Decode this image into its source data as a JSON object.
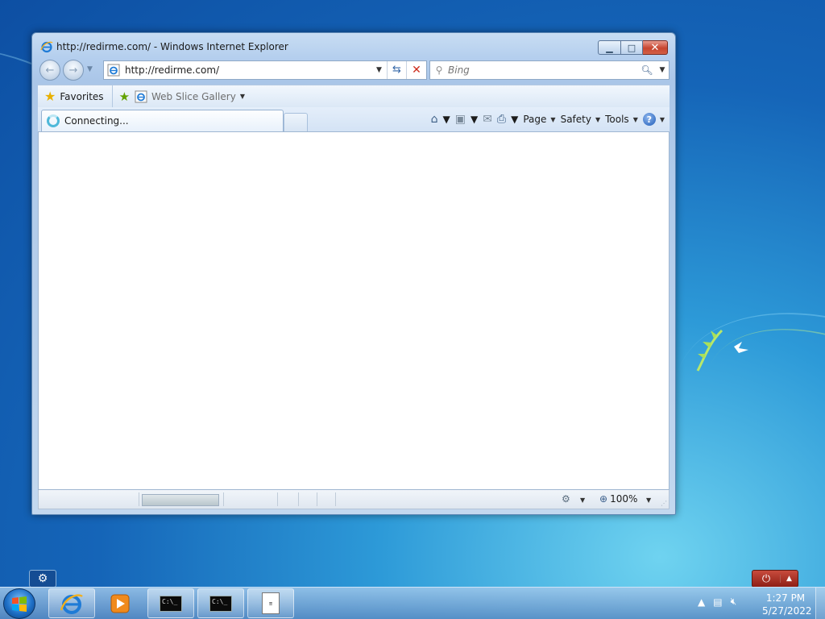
{
  "window": {
    "title": "http://redirme.com/ - Windows Internet Explorer",
    "minimize_glyph": "▁",
    "maximize_glyph": "□",
    "close_glyph": "✕"
  },
  "navbar": {
    "back_glyph": "←",
    "forward_glyph": "→",
    "address": "http://redirme.com/",
    "search_placeholder": "Bing"
  },
  "favorites_bar": {
    "favorites_label": "Favorites",
    "web_slice_label": "Web Slice Gallery"
  },
  "tabs": [
    {
      "label": "Connecting...",
      "state": "loading"
    }
  ],
  "command_bar": {
    "page_label": "Page",
    "safety_label": "Safety",
    "tools_label": "Tools"
  },
  "statusbar": {
    "progress": 1.0,
    "zoom": "100%"
  },
  "taskbar": {
    "clock_time": "1:27 PM",
    "clock_date": "5/27/2022",
    "cmd_label": "C:\\_",
    "items": [
      "internet-explorer",
      "windows-media-player",
      "command-prompt",
      "command-prompt",
      "notepad-document"
    ]
  },
  "icons": {
    "ie": "ie-icon",
    "favorites": "star-icon",
    "home": "home-icon",
    "feeds": "rss-icon",
    "mail": "mail-icon",
    "print": "print-icon",
    "help": "help-icon",
    "zoom": "magnifier-icon",
    "refresh": "refresh-icon",
    "stop": "stop-icon"
  },
  "colors": {
    "desktop_top": "#0d4fa3",
    "desktop_glow": "#6fd3f0",
    "window_frame": "#b5cfee",
    "close_button": "#c7452f"
  }
}
